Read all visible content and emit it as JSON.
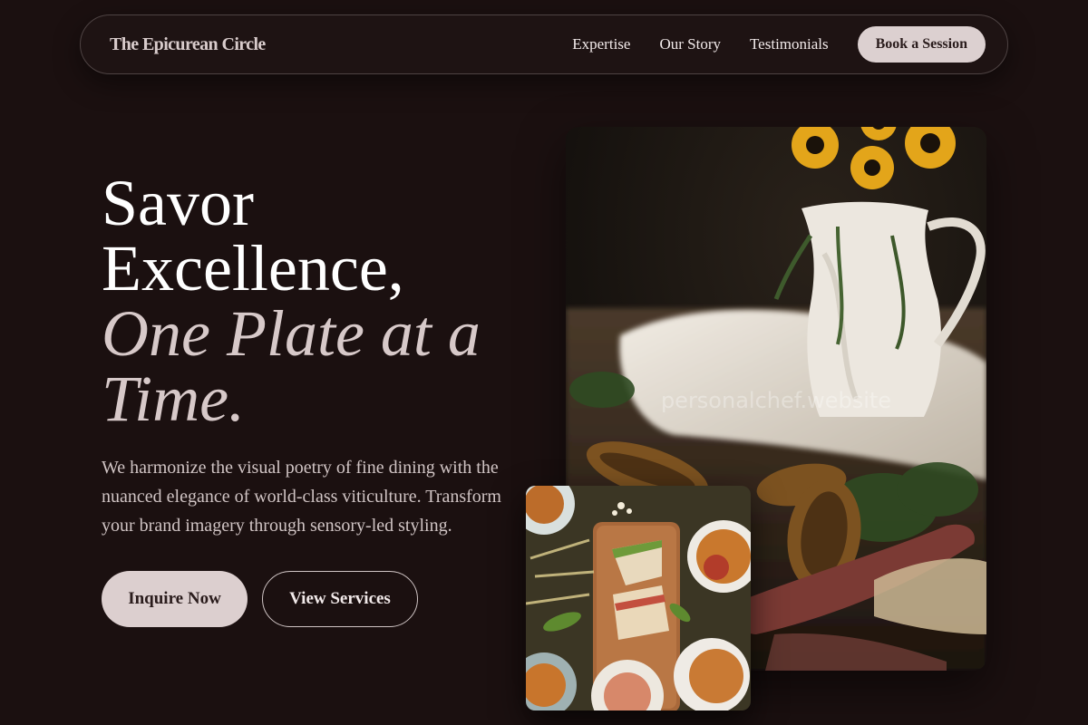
{
  "nav": {
    "brand": "The Epicurean Circle",
    "links": [
      "Expertise",
      "Our Story",
      "Testimonials"
    ],
    "cta": "Book a Session"
  },
  "hero": {
    "headline_line1": "Savor Excellence,",
    "headline_accent": "One Plate at a Time.",
    "subtext": "We harmonize the visual poetry of fine dining with the nuanced elegance of world-class viticulture. Transform your brand imagery through sensory-led styling.",
    "primary_button": "Inquire Now",
    "secondary_button": "View Services"
  },
  "images": {
    "main_photo_watermark": "personalchef.website",
    "main_photo_icon": "still-life-photo-icon",
    "inset_photo_icon": "sandwich-platter-photo-icon"
  },
  "colors": {
    "background": "#1b1010",
    "button_light": "#dccfcf",
    "accent_text": "#d7c9c9"
  }
}
